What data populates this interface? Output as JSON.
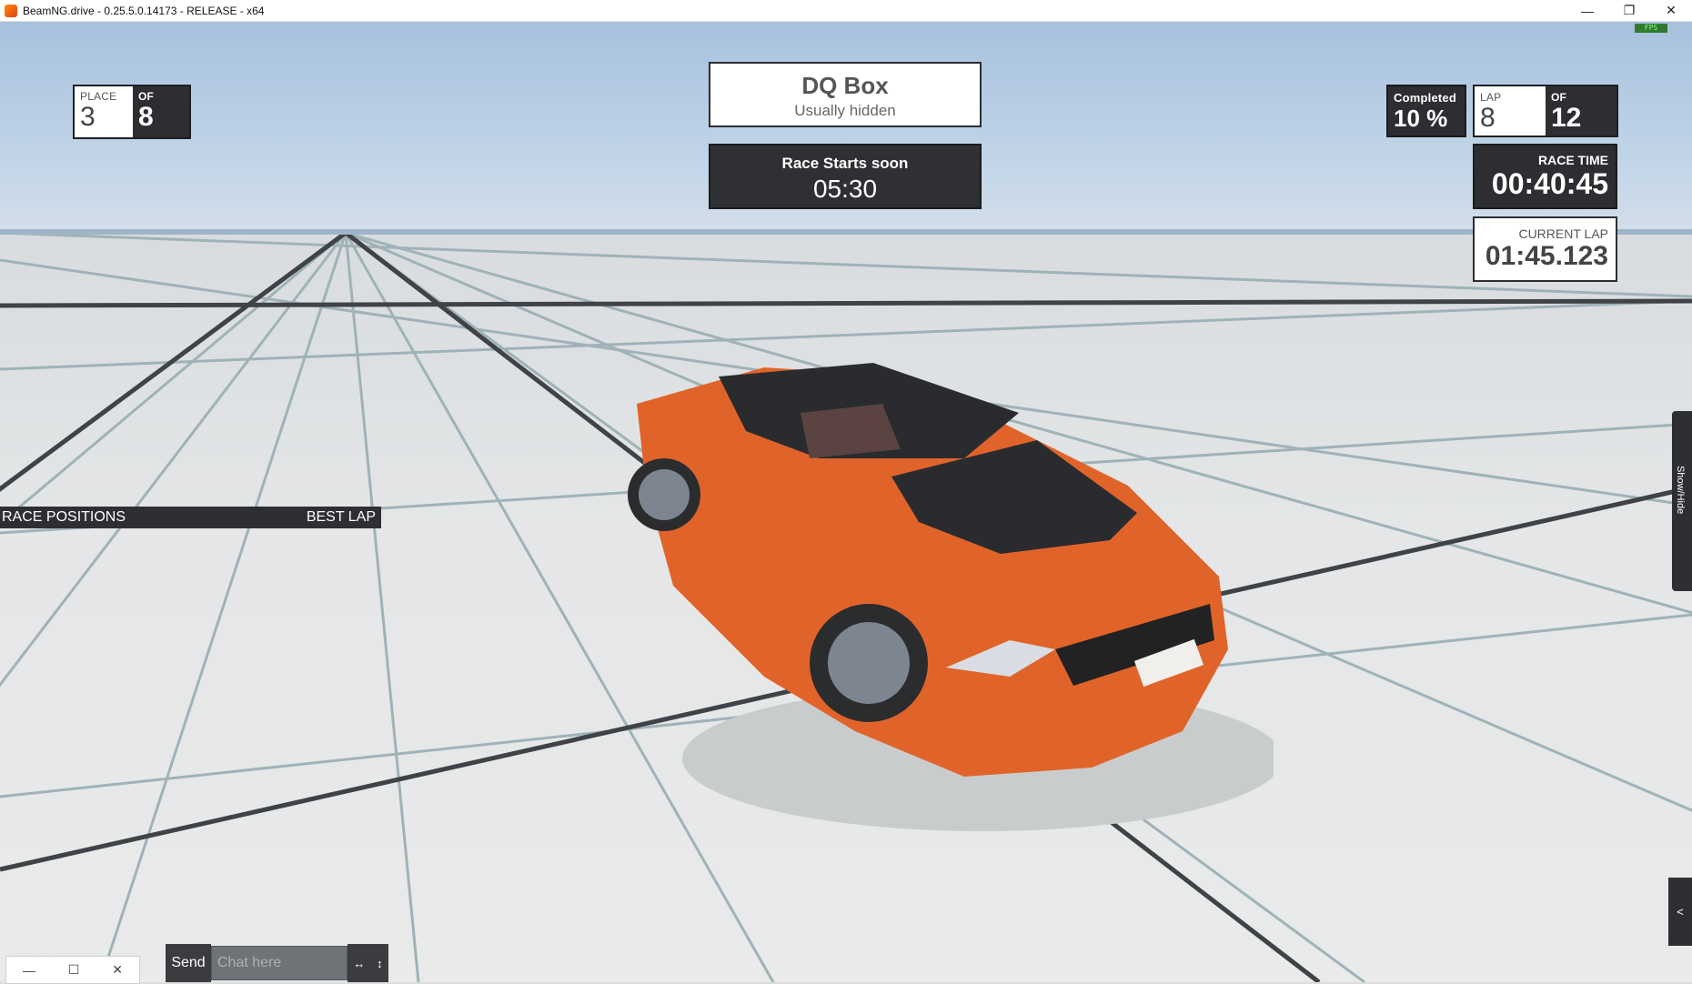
{
  "window": {
    "title": "BeamNG.drive - 0.25.5.0.14173 - RELEASE - x64",
    "minimize": "—",
    "restore": "❐",
    "close": "✕"
  },
  "hud": {
    "place": {
      "label": "PLACE",
      "value": "3",
      "of_label": "OF",
      "of_value": "8"
    },
    "dq": {
      "title": "DQ Box",
      "subtitle": "Usually hidden"
    },
    "race_start": {
      "title": "Race Starts soon",
      "time": "05:30"
    },
    "completed": {
      "label": "Completed",
      "value": "10 %"
    },
    "lap": {
      "label": "LAP",
      "value": "8",
      "of_label": "OF",
      "of_value": "12"
    },
    "race_time": {
      "label": "RACE TIME",
      "value": "00:40:45"
    },
    "current_lap": {
      "label": "CURRENT LAP",
      "value": "01:45.123"
    },
    "positions": {
      "left_label": "RACE POSITIONS",
      "right_label": "BEST LAP"
    },
    "showhide": "Show/Hide",
    "collapse": "<"
  },
  "chat": {
    "send_label": "Send",
    "placeholder": "Chat here",
    "resize_h": "↔",
    "resize_v": "↕"
  },
  "mini_window": {
    "minimize": "—",
    "maximize": "☐",
    "close": "✕"
  },
  "colors": {
    "car_body": "#e0642a",
    "car_hood": "#2a2b2e",
    "hud_dark": "#2c2e31"
  }
}
